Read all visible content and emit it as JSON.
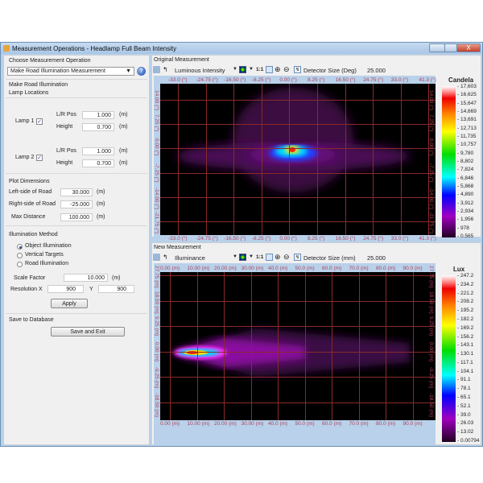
{
  "window": {
    "title": "Measurement Operations - Headlamp Full Beam Intensity",
    "close": "X"
  },
  "left": {
    "choose_label": "Choose Measurement Operation",
    "operation_select": "Make Road Illumination Measurement",
    "section_road": "Make Road Illumination",
    "section_lamps": "Lamp Locations",
    "lamp1": {
      "label": "Lamp 1",
      "checked": true,
      "lr_label": "L/R Pos",
      "lr": "1.000",
      "h_label": "Height",
      "h": "0.700",
      "unit": "(m)"
    },
    "lamp2": {
      "label": "Lamp 2",
      "checked": true,
      "lr_label": "L/R Pos",
      "lr": "1.000",
      "h_label": "Height",
      "h": "0.700",
      "unit": "(m)"
    },
    "section_plot": "Plot Dimensions",
    "left_road_label": "Left-side of Road",
    "left_road": "30.000",
    "right_road_label": "Right-side of Road",
    "right_road": "-25.000",
    "max_dist_label": "Max Distance",
    "max_dist": "100.000",
    "unit": "(m)",
    "section_method": "Illumination Method",
    "methods": [
      {
        "label": "Object Illumination",
        "selected": true
      },
      {
        "label": "Vertical Targets",
        "selected": false
      },
      {
        "label": "Road Illumination",
        "selected": false
      }
    ],
    "scale_label": "Scale Factor",
    "scale": "10.000",
    "resx_label": "Resolution X",
    "resx": "900",
    "resy_label": "Y",
    "resy": "900",
    "apply": "Apply",
    "section_save": "Save to Database",
    "save_exit": "Save and Exit"
  },
  "original": {
    "title": "Original Measurement",
    "quantity": "Luminous Intensity",
    "one_to_one": "1:1",
    "detector_label": "Detector Size (Deg)",
    "detector": "25.000",
    "x_labels": [
      "-33.0 (°)",
      "-24.75 (°)",
      "-16.50 (°)",
      "-8.25 (°)",
      "0.00 (°)",
      "8.25 (°)",
      "16.50 (°)",
      "24.75 (°)",
      "33.0 (°)",
      "41.3 (°)"
    ],
    "y_labels": [
      "14.00 (°)",
      "7.25 (°)",
      "0.00 (°)",
      "-7.25 (°)",
      "-14.00 (°)",
      "-21.75 (°)"
    ],
    "unit": "Candela",
    "scale_ticks": [
      "17,603",
      "16,625",
      "15,647",
      "14,669",
      "13,691",
      "12,713",
      "11,735",
      "10,757",
      "9,780",
      "8,802",
      "7,824",
      "6,846",
      "5,868",
      "4,890",
      "3,912",
      "2,934",
      "1,956",
      "978",
      "0.565"
    ]
  },
  "new": {
    "title": "New Measurement",
    "quantity": "Illuminance",
    "one_to_one": "1:1",
    "detector_label": "Detector Size (mm)",
    "detector": "25.000",
    "x_labels": [
      "0.00 (m)",
      "10.00 (m)",
      "20.00 (m)",
      "30.00 (m)",
      "40.0 (m)",
      "50.0 (m)",
      "60.0 (m)",
      "70.0 (m)",
      "80.0 (m)",
      "90.0 (m)"
    ],
    "y_labels": [
      "27.75 (m)",
      "18.50 (m)",
      "9.25 (m)",
      "0.00 (m)",
      "-9.25 (m)",
      "-18.50 (m)"
    ],
    "unit": "Lux",
    "scale_ticks": [
      "247.2",
      "234.2",
      "221.2",
      "208.2",
      "195.2",
      "182.2",
      "169.2",
      "156.2",
      "143.1",
      "130.1",
      "117.1",
      "104.1",
      "91.1",
      "78.1",
      "65.1",
      "52.1",
      "39.0",
      "26.03",
      "13.02",
      "0.00794"
    ]
  },
  "colors": {
    "grid": "#8a2a2a",
    "axis_label": "#b0405a",
    "window_frame": "#b9d1ea"
  }
}
